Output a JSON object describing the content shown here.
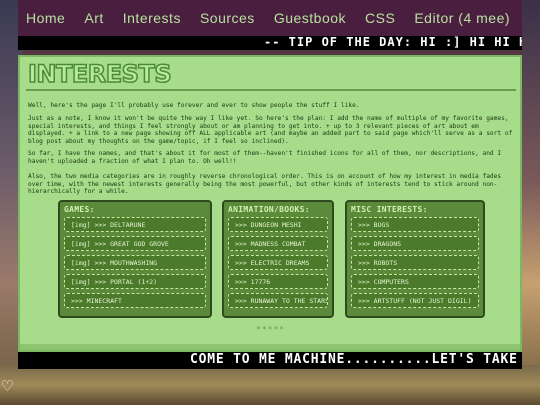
{
  "nav": {
    "items": [
      "Home",
      "Art",
      "Interests",
      "Sources",
      "Guestbook",
      "CSS",
      "Editor (4 mee)"
    ]
  },
  "ticker_top": "-- TIP OF THE DAY: HI :] HI HI HE",
  "page": {
    "heading": "INTERESTS",
    "paragraphs": [
      "Well, here's the page I'll probably use forever and ever to show people the stuff I like.",
      "Just as a note, I know it won't be quite the way I like yet. So here's the plan: I add the name of multiple of my favorite games, special interests, and things I feel strongly about or am planning to get into. + up to 3 relevant pieces of art about em displayed. + a link to a new page showing off ALL applicable art (and maybe an added part to said page which'll serve as a sort of blog post about my thoughts on the game/topic, if I feel so inclined).",
      "So far, I have the names, and that's about it for most of them--haven't finished icons for all of them, nor descriptions, and I haven't uploaded a fraction of what I plan to. Oh well!!",
      "Also, the two media categories are in roughly reverse chronological order. This is on account of how my interest in media fades over time, with the newest interests generally being the most powerful, but other kinds of interests tend to stick around non-hierarchically for a while."
    ]
  },
  "columns": [
    {
      "title": "GAMES:",
      "items": [
        "[img] >>> DELTARUNE",
        "[img] >>> GREAT GOD GROVE",
        "[img] >>> MOUTHWASHING",
        "[img] >>> PORTAL (1+2)",
        ">>> MINECRAFT"
      ]
    },
    {
      "title": "ANIMATION/BOOKS:",
      "items": [
        ">>> DUNGEON MESHI",
        ">>> MADNESS COMBAT",
        ">>> ELECTRIC DREAMS",
        ">>> 17776",
        ">>> RUNAWAY TO THE STARS"
      ]
    },
    {
      "title": "MISC INTERESTS:",
      "items": [
        ">>> BUGS",
        ">>> DRAGONS",
        ">>> ROBOTS",
        ">>> COMPUTERS",
        ">>> ARTSTUFF (NOT JUST DIGIL)"
      ]
    }
  ],
  "stars": "*****",
  "ticker_bottom": "COME TO ME MACHINE..........LET'S TAKE IBU",
  "colors": {
    "panel": "#a6dc8a",
    "nav": "#4a1e3e",
    "accent": "#5a8a3a"
  }
}
